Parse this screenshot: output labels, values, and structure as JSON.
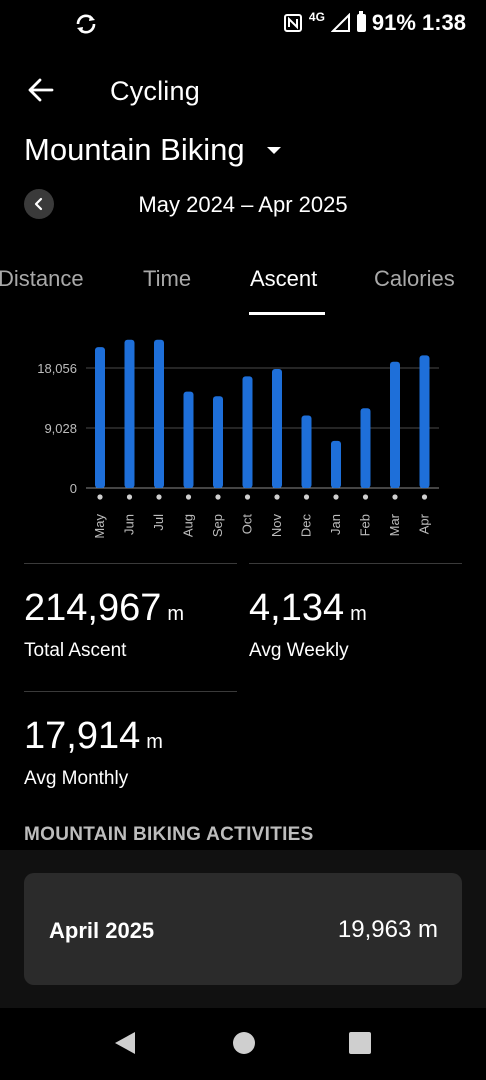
{
  "status_bar": {
    "battery": "91%",
    "time": "1:38",
    "network": "4G",
    "icons": [
      "sync-icon",
      "nfc-icon",
      "signal-icon",
      "battery-icon"
    ]
  },
  "app_bar": {
    "title": "Cycling"
  },
  "sport_selector": {
    "label": "Mountain Biking"
  },
  "date_range": {
    "label": "May 2024 – Apr 2025"
  },
  "tabs": [
    "Distance",
    "Time",
    "Ascent",
    "Calories"
  ],
  "active_tab": "Ascent",
  "chart_data": {
    "type": "bar",
    "categories": [
      "May",
      "Jun",
      "Jul",
      "Aug",
      "Sep",
      "Oct",
      "Nov",
      "Dec",
      "Jan",
      "Feb",
      "Mar",
      "Apr"
    ],
    "values": [
      21200,
      22300,
      22300,
      14500,
      13800,
      16800,
      17900,
      10900,
      7100,
      12000,
      19000,
      19963
    ],
    "yticks": [
      "18,056",
      "9,028",
      "0"
    ],
    "ytick_values": [
      18056,
      9028,
      0
    ],
    "ylim": [
      0,
      27084
    ],
    "grid": true,
    "bar_color": "#1e6fd9"
  },
  "stats": {
    "total": {
      "value": "214,967",
      "unit": "m",
      "label": "Total Ascent"
    },
    "weekly": {
      "value": "4,134",
      "unit": "m",
      "label": "Avg Weekly"
    },
    "monthly": {
      "value": "17,914",
      "unit": "m",
      "label": "Avg Monthly"
    }
  },
  "activities": {
    "section_title": "MOUNTAIN BIKING ACTIVITIES",
    "items": [
      {
        "label": "April 2025",
        "value": "19,963 m"
      }
    ]
  }
}
